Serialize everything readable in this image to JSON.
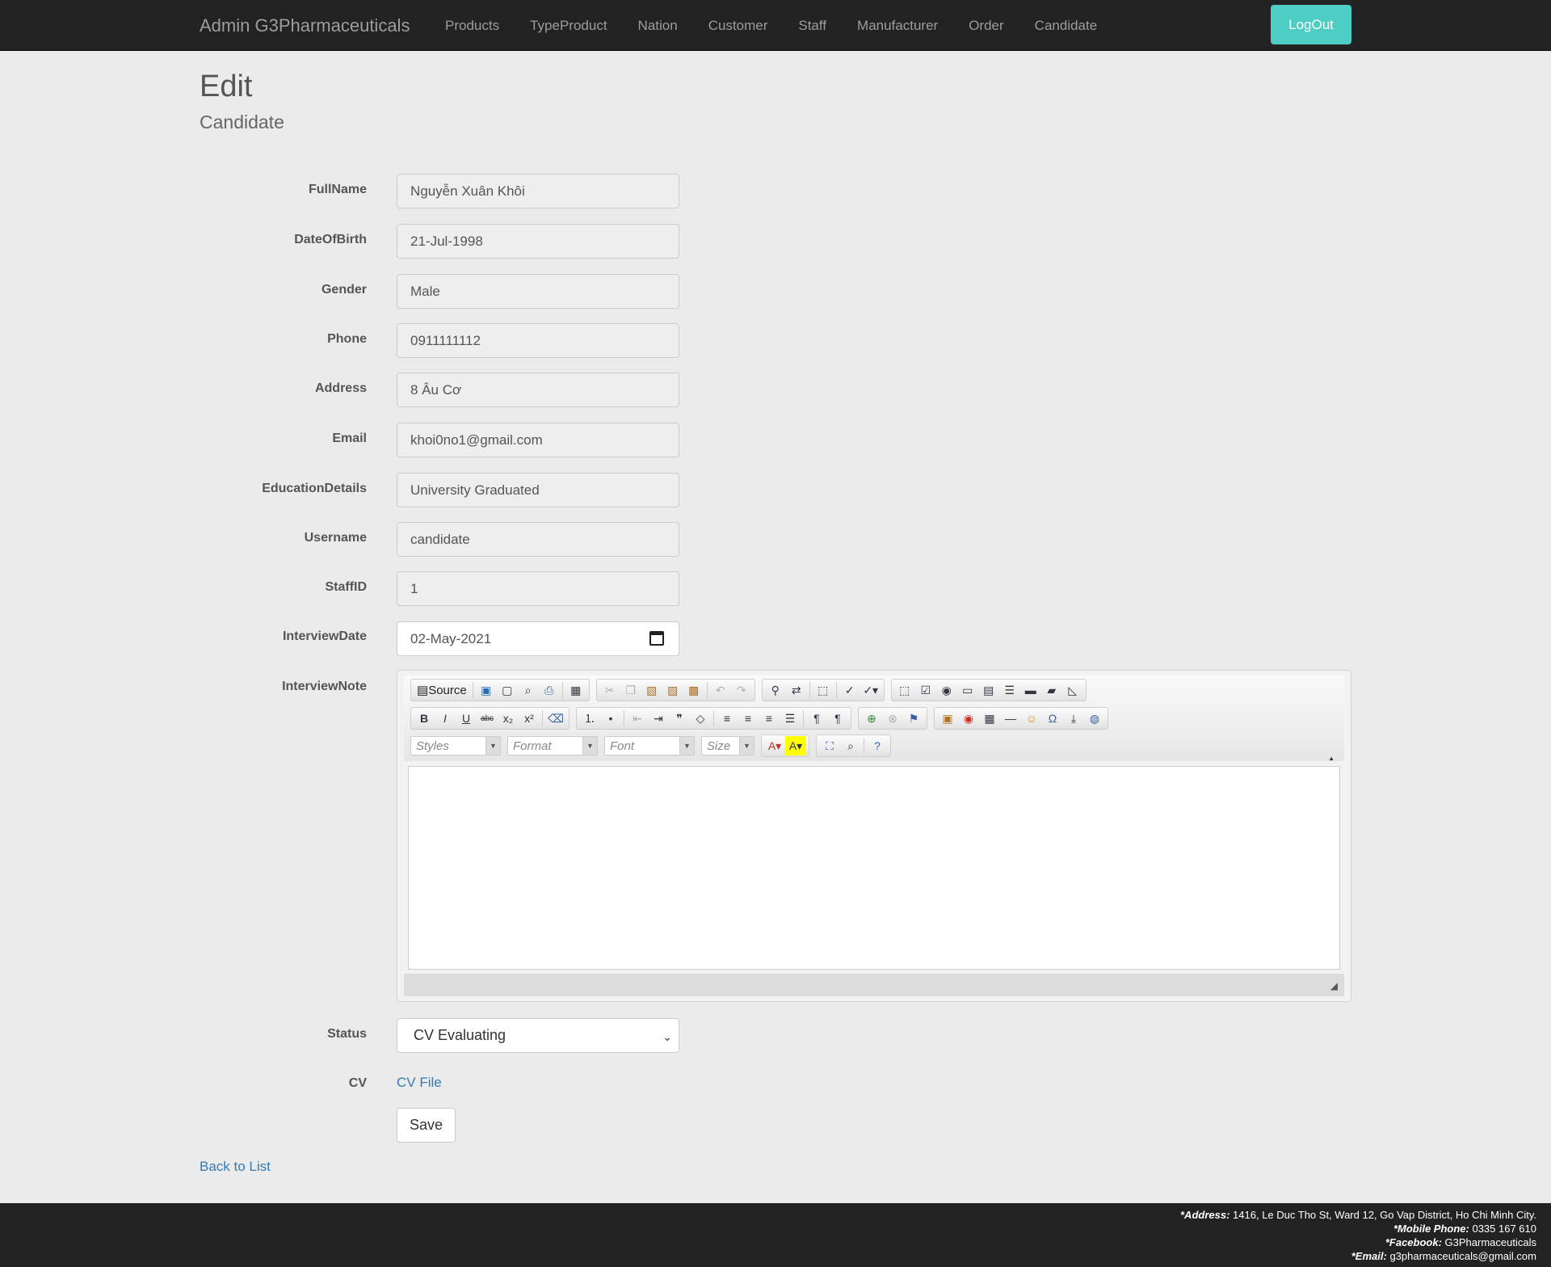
{
  "navbar": {
    "brand": "Admin G3Pharmaceuticals",
    "links": [
      "Products",
      "TypeProduct",
      "Nation",
      "Customer",
      "Staff",
      "Manufacturer",
      "Order",
      "Candidate"
    ],
    "logout": "LogOut"
  },
  "page": {
    "title": "Edit",
    "subtitle": "Candidate"
  },
  "form": {
    "fields": [
      {
        "label": "FullName",
        "value": "Nguyễn Xuân Khôi"
      },
      {
        "label": "DateOfBirth",
        "value": "21-Jul-1998"
      },
      {
        "label": "Gender",
        "value": "Male"
      },
      {
        "label": "Phone",
        "value": "0911111112"
      },
      {
        "label": "Address",
        "value": "8 Âu Cơ"
      },
      {
        "label": "Email",
        "value": "khoi0no1@gmail.com"
      },
      {
        "label": "EducationDetails",
        "value": "University Graduated"
      },
      {
        "label": "Username",
        "value": "candidate"
      },
      {
        "label": "StaffID",
        "value": "1"
      },
      {
        "label": "InterviewDate",
        "value": "02-May-2021"
      }
    ],
    "interview_note_label": "InterviewNote",
    "editor": {
      "source_label": "Source",
      "styles_placeholder": "Styles",
      "format_placeholder": "Format",
      "font_placeholder": "Font",
      "size_placeholder": "Size"
    },
    "status_label": "Status",
    "status_value": "CV Evaluating",
    "cv_label": "CV",
    "cv_link": "CV File",
    "save": "Save"
  },
  "back_link": "Back to List",
  "footer": {
    "address_label": "*Address:",
    "address": "1416, Le Duc Tho St, Ward 12, Go Vap District, Ho Chi Minh City.",
    "phone_label": "*Mobile Phone:",
    "phone": "0335 167 610",
    "facebook_label": "*Facebook:",
    "facebook": "G3Pharmaceuticals",
    "email_label": "*Email:",
    "email": "g3pharmaceuticals@gmail.com"
  },
  "colors": {
    "accent": "#4ecdc4",
    "navbar": "#222222",
    "link": "#337ab7"
  }
}
